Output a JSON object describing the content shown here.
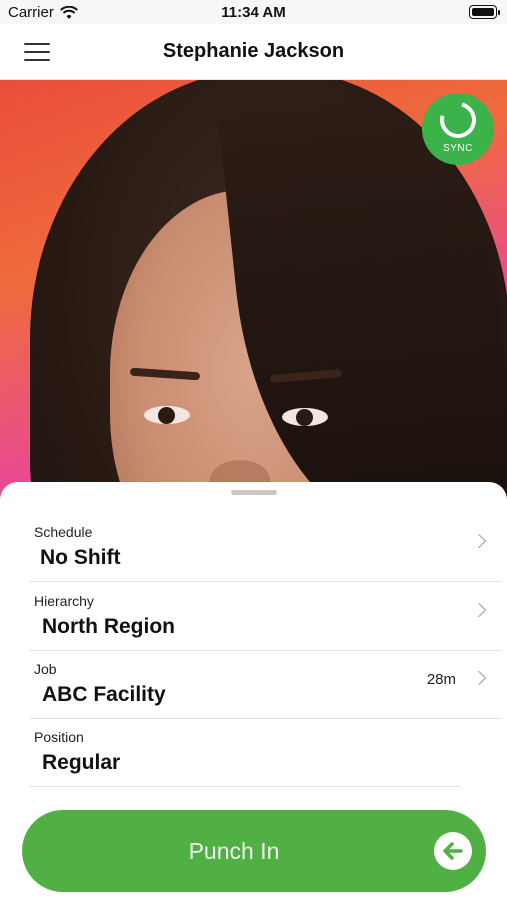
{
  "status_bar": {
    "carrier": "Carrier",
    "time": "11:34 AM",
    "icons": [
      "wifi-icon",
      "battery-icon"
    ]
  },
  "nav": {
    "title": "Stephanie Jackson",
    "menu_icon": "hamburger-menu-icon"
  },
  "photo": {
    "description_icon": "employee-photo"
  },
  "sync": {
    "label": "SYNC",
    "color": "#3bb24a"
  },
  "details": {
    "schedule": {
      "label": "Schedule",
      "value": "No Shift"
    },
    "hierarchy": {
      "label": "Hierarchy",
      "value": "North Region"
    },
    "job": {
      "label": "Job",
      "value": "ABC Facility",
      "meta": "28m"
    },
    "position": {
      "label": "Position",
      "value": "Regular"
    }
  },
  "punch": {
    "label": "Punch In",
    "color": "#51b043",
    "icon": "arrow-left-circle-icon"
  }
}
